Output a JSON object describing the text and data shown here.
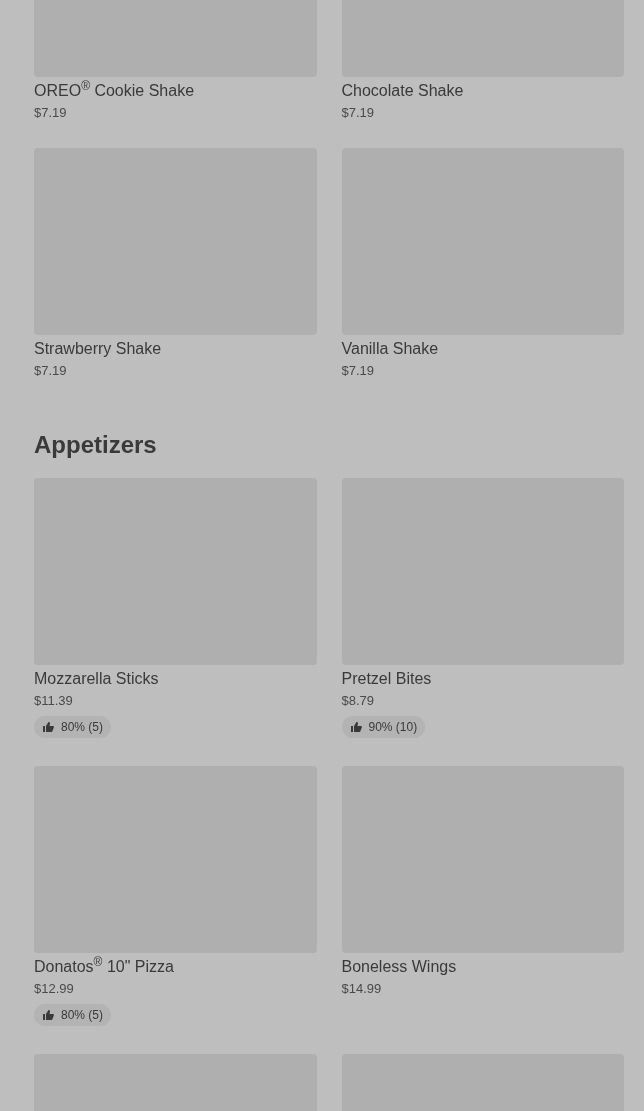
{
  "sections": [
    {
      "items": [
        {
          "kind": "dish",
          "name": "OREO$^{®}$ Cookie Shake",
          "price": "$7.19"
        },
        {
          "kind": "dish",
          "name": "Chocolate Shake",
          "price": "$7.19"
        },
        {
          "kind": "dish",
          "name": "Strawberry Shake",
          "price": "$7.19"
        },
        {
          "kind": "dish",
          "name": "Vanilla Shake",
          "price": "$7.19"
        }
      ]
    },
    {
      "title": "Appetizers",
      "items": [
        {
          "kind": "dish",
          "name": "Mozzarella Sticks",
          "price": "$11.39",
          "rating": "80% (5)"
        },
        {
          "kind": "dish",
          "name": "Pretzel Bites",
          "price": "$8.79",
          "rating": "90% (10)"
        },
        {
          "kind": "dish",
          "name": "Donatos$^{®}$ 10\" Pizza",
          "price": "$12.99",
          "rating": "80% (5)"
        },
        {
          "kind": "dish",
          "name": "Boneless Wings",
          "price": "$14.99"
        },
        {
          "kind": "image"
        },
        {
          "kind": "image"
        }
      ]
    }
  ]
}
